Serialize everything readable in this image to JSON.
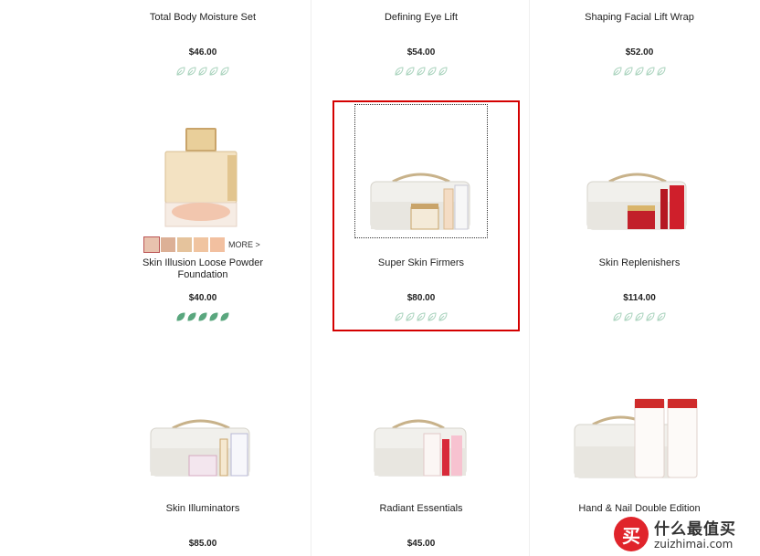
{
  "products": [
    {
      "name": "Total Body Moisture Set",
      "price": "$46.00",
      "rating_filled": 0,
      "rating_max": 5
    },
    {
      "name": "Defining Eye Lift",
      "price": "$54.00",
      "rating_filled": 0,
      "rating_max": 5
    },
    {
      "name": "Shaping Facial Lift Wrap",
      "price": "$52.00",
      "rating_filled": 0,
      "rating_max": 5
    },
    {
      "name": "Skin Illusion Loose Powder Foundation",
      "price": "$40.00",
      "rating_filled": 5,
      "rating_max": 5
    },
    {
      "name": "Super Skin Firmers",
      "price": "$80.00",
      "rating_filled": 0,
      "rating_max": 5
    },
    {
      "name": "Skin Replenishers",
      "price": "$114.00",
      "rating_filled": 0,
      "rating_max": 5
    },
    {
      "name": "Skin Illuminators",
      "price": "$85.00"
    },
    {
      "name": "Radiant Essentials",
      "price": "$45.00"
    },
    {
      "name": "Hand & Nail Double Edition",
      "price": ""
    }
  ],
  "swatches": {
    "colors": [
      "#e8c2ae",
      "#dcb096",
      "#e5c39c",
      "#f0c4a0",
      "#f2c0a0"
    ],
    "more_label": "MORE >"
  },
  "rating_colors": {
    "filled": "#5aa77e",
    "empty": "#a9d3bd"
  },
  "watermark": {
    "logo_glyph": "买",
    "title": "什么最值买",
    "subtitle": "zuizhimai.com"
  }
}
